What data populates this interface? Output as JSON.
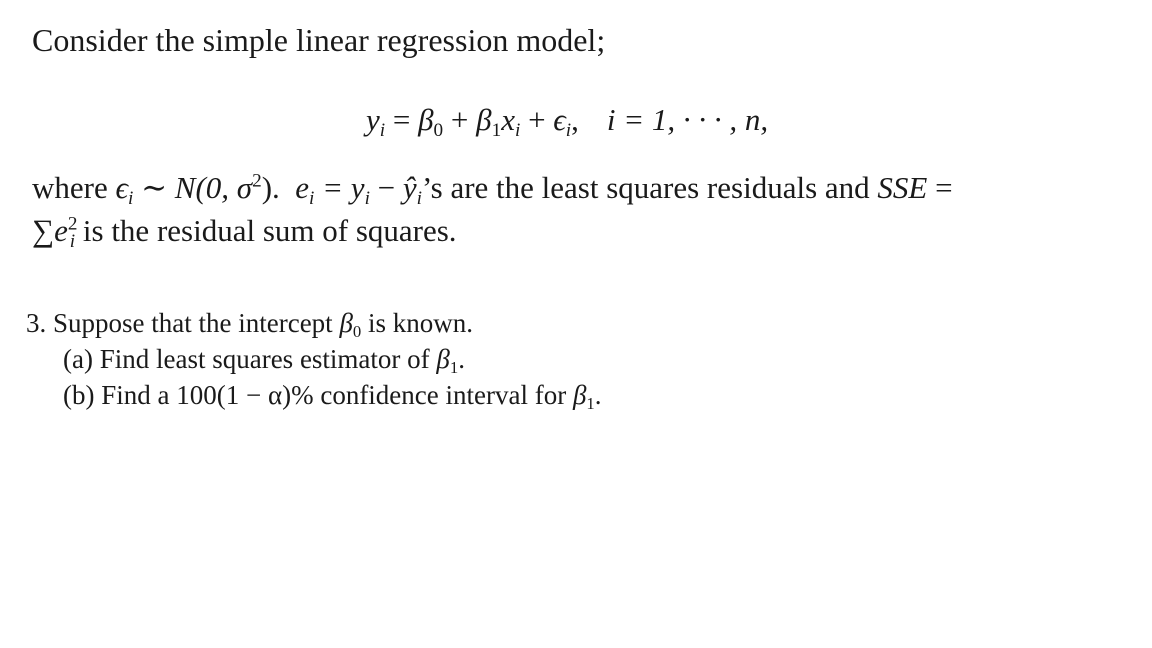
{
  "intro": "Consider the simple linear regression model;",
  "equation": {
    "lhs": "y",
    "lhs_sub": "i",
    "rhs_parts": [
      "β",
      "0",
      "β",
      "1",
      "x",
      "i",
      "ϵ",
      "i"
    ],
    "index_range": "i = 1, · · · , n,"
  },
  "where_line": {
    "prefix": "where",
    "error_dist": "ϵ",
    "error_sub": "i",
    "dist": "∼ N(0, σ",
    "dist_exp": "2",
    "dist_end": ").",
    "residual_def": "e",
    "residual_sub": "i",
    "residual_eq": " = y",
    "yhat_sub": "i",
    "yhat": "ŷ",
    "suffix": "’s are the least squares residuals and",
    "sse": "SSE",
    "sse_eq": "="
  },
  "sse_line": {
    "sum": "∑",
    "term": "e",
    "term_sub": "i",
    "term_exp": "2",
    "suffix": "is the residual sum of squares."
  },
  "question": {
    "number": "3.",
    "text_before": "Suppose that the intercept",
    "beta": "β",
    "beta_sub": "0",
    "text_after": "is known.",
    "parts": [
      {
        "label": "(a)",
        "text": "Find least squares estimator of",
        "beta": "β",
        "beta_sub": "1",
        "end": "."
      },
      {
        "label": "(b)",
        "text": "Find a 100(1 − α)% confidence interval for",
        "beta": "β",
        "beta_sub": "1",
        "end": "."
      }
    ]
  }
}
